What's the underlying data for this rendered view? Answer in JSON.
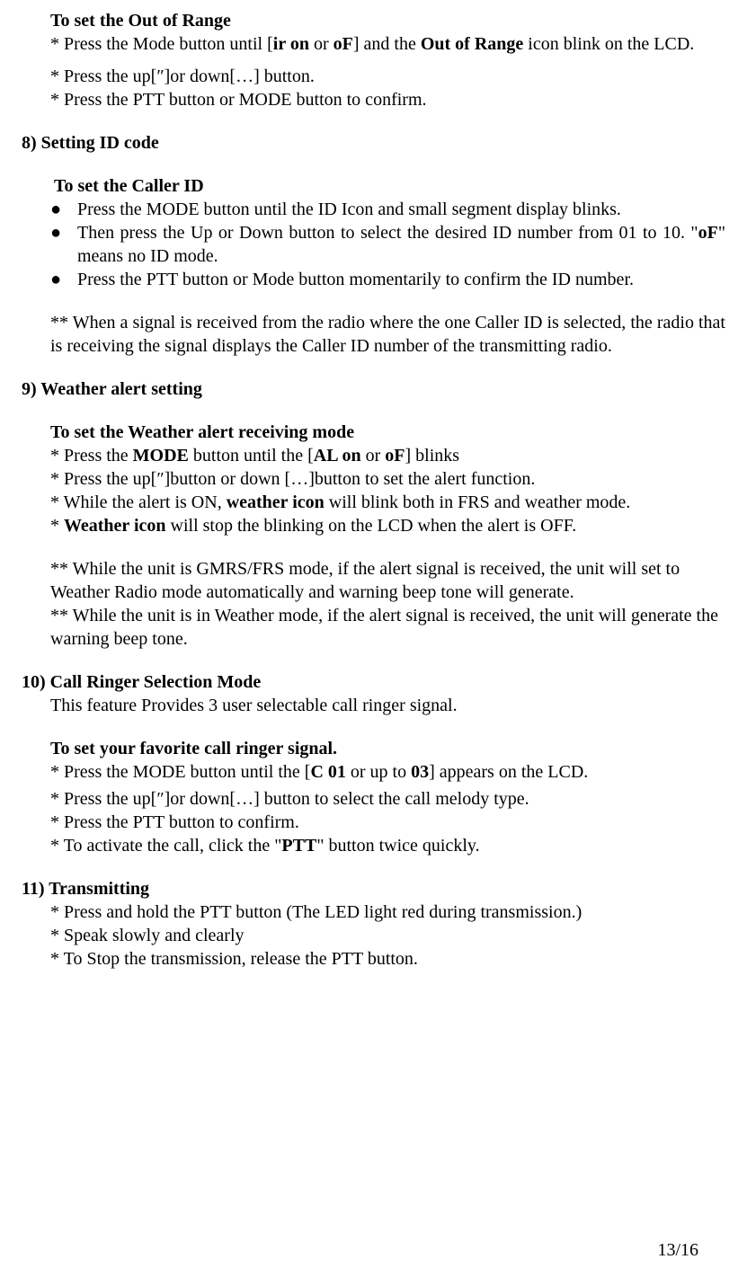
{
  "s7": {
    "subtitle": "To set the Out of Range",
    "line1_a": "* Press the Mode button until [",
    "line1_b": "ir on",
    "line1_c": " or ",
    "line1_d": "oF",
    "line1_e": "] and the ",
    "line1_f": "Out of Range",
    "line1_g": "  icon blink on the LCD.",
    "line2": "* Press the up[″]or down[…] button.",
    "line3": "* Press the PTT button or MODE button to confirm."
  },
  "s8": {
    "heading": "8)  Setting ID code",
    "subtitle": "To set the Caller ID",
    "b1": "Press the MODE button until the ID Icon and small segment display blinks.",
    "b2_a": "Then press the Up or Down button to select the desired ID number from 01 to 10. \"",
    "b2_b": "oF",
    "b2_c": "\" means no ID mode.",
    "b3": "Press the PTT button or Mode button momentarily to confirm the ID number.",
    "note": "** When a signal is received from the radio where the one Caller ID is selected, the radio that is receiving the signal displays the Caller ID number of the transmitting radio."
  },
  "s9": {
    "heading": "9)  Weather alert setting",
    "subtitle": "To set the Weather alert receiving mode",
    "l1_a": "* Press the ",
    "l1_b": "MODE",
    "l1_c": " button until the [",
    "l1_d": "AL on",
    "l1_e": " or ",
    "l1_f": "oF",
    "l1_g": "] blinks",
    "l2": "* Press the up[″]button or down […]button to set the alert function.",
    "l3_a": "* While the alert is ON, ",
    "l3_b": "weather icon",
    "l3_c": " will blink both in FRS and weather mode.",
    "l4_a": "* ",
    "l4_b": "Weather icon",
    "l4_c": " will stop the blinking on the LCD when the alert is OFF.",
    "n1": "** While the unit is GMRS/FRS mode, if the alert signal is received, the unit will set to Weather Radio mode automatically and warning beep tone will generate.",
    "n2": "** While the unit is in Weather mode, if the alert signal is received, the unit will generate the warning beep tone."
  },
  "s10": {
    "heading": "10) Call Ringer Selection Mode",
    "intro": "This feature Provides 3 user selectable call ringer signal.",
    "subtitle": "To set your favorite call ringer signal.",
    "l1_a": "* Press the MODE button until the [",
    "l1_b": "C 01",
    "l1_c": " or up to ",
    "l1_d": "03",
    "l1_e": "] appears on the LCD.",
    "l2": "* Press the up[″]or down[…] button to select the call melody type.",
    "l3": "* Press the PTT button to confirm.",
    "l4_a": "* To activate the call, click the \"",
    "l4_b": "PTT",
    "l4_c": "\" button twice quickly."
  },
  "s11": {
    "heading": "11) Transmitting",
    "l1": "* Press and hold the PTT button (The LED light red during transmission.)",
    "l2": "* Speak slowly and clearly",
    "l3": "* To Stop the transmission, release the PTT button."
  },
  "bullet": "●",
  "page": "13/16"
}
